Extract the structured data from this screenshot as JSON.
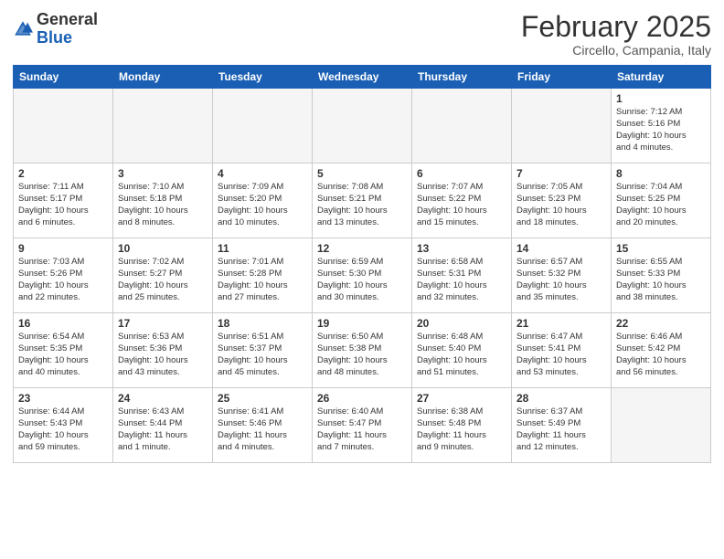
{
  "header": {
    "logo": {
      "general": "General",
      "blue": "Blue"
    },
    "title": "February 2025",
    "location": "Circello, Campania, Italy"
  },
  "weekdays": [
    "Sunday",
    "Monday",
    "Tuesday",
    "Wednesday",
    "Thursday",
    "Friday",
    "Saturday"
  ],
  "weeks": [
    [
      {
        "day": "",
        "info": ""
      },
      {
        "day": "",
        "info": ""
      },
      {
        "day": "",
        "info": ""
      },
      {
        "day": "",
        "info": ""
      },
      {
        "day": "",
        "info": ""
      },
      {
        "day": "",
        "info": ""
      },
      {
        "day": "1",
        "info": "Sunrise: 7:12 AM\nSunset: 5:16 PM\nDaylight: 10 hours\nand 4 minutes."
      }
    ],
    [
      {
        "day": "2",
        "info": "Sunrise: 7:11 AM\nSunset: 5:17 PM\nDaylight: 10 hours\nand 6 minutes."
      },
      {
        "day": "3",
        "info": "Sunrise: 7:10 AM\nSunset: 5:18 PM\nDaylight: 10 hours\nand 8 minutes."
      },
      {
        "day": "4",
        "info": "Sunrise: 7:09 AM\nSunset: 5:20 PM\nDaylight: 10 hours\nand 10 minutes."
      },
      {
        "day": "5",
        "info": "Sunrise: 7:08 AM\nSunset: 5:21 PM\nDaylight: 10 hours\nand 13 minutes."
      },
      {
        "day": "6",
        "info": "Sunrise: 7:07 AM\nSunset: 5:22 PM\nDaylight: 10 hours\nand 15 minutes."
      },
      {
        "day": "7",
        "info": "Sunrise: 7:05 AM\nSunset: 5:23 PM\nDaylight: 10 hours\nand 18 minutes."
      },
      {
        "day": "8",
        "info": "Sunrise: 7:04 AM\nSunset: 5:25 PM\nDaylight: 10 hours\nand 20 minutes."
      }
    ],
    [
      {
        "day": "9",
        "info": "Sunrise: 7:03 AM\nSunset: 5:26 PM\nDaylight: 10 hours\nand 22 minutes."
      },
      {
        "day": "10",
        "info": "Sunrise: 7:02 AM\nSunset: 5:27 PM\nDaylight: 10 hours\nand 25 minutes."
      },
      {
        "day": "11",
        "info": "Sunrise: 7:01 AM\nSunset: 5:28 PM\nDaylight: 10 hours\nand 27 minutes."
      },
      {
        "day": "12",
        "info": "Sunrise: 6:59 AM\nSunset: 5:30 PM\nDaylight: 10 hours\nand 30 minutes."
      },
      {
        "day": "13",
        "info": "Sunrise: 6:58 AM\nSunset: 5:31 PM\nDaylight: 10 hours\nand 32 minutes."
      },
      {
        "day": "14",
        "info": "Sunrise: 6:57 AM\nSunset: 5:32 PM\nDaylight: 10 hours\nand 35 minutes."
      },
      {
        "day": "15",
        "info": "Sunrise: 6:55 AM\nSunset: 5:33 PM\nDaylight: 10 hours\nand 38 minutes."
      }
    ],
    [
      {
        "day": "16",
        "info": "Sunrise: 6:54 AM\nSunset: 5:35 PM\nDaylight: 10 hours\nand 40 minutes."
      },
      {
        "day": "17",
        "info": "Sunrise: 6:53 AM\nSunset: 5:36 PM\nDaylight: 10 hours\nand 43 minutes."
      },
      {
        "day": "18",
        "info": "Sunrise: 6:51 AM\nSunset: 5:37 PM\nDaylight: 10 hours\nand 45 minutes."
      },
      {
        "day": "19",
        "info": "Sunrise: 6:50 AM\nSunset: 5:38 PM\nDaylight: 10 hours\nand 48 minutes."
      },
      {
        "day": "20",
        "info": "Sunrise: 6:48 AM\nSunset: 5:40 PM\nDaylight: 10 hours\nand 51 minutes."
      },
      {
        "day": "21",
        "info": "Sunrise: 6:47 AM\nSunset: 5:41 PM\nDaylight: 10 hours\nand 53 minutes."
      },
      {
        "day": "22",
        "info": "Sunrise: 6:46 AM\nSunset: 5:42 PM\nDaylight: 10 hours\nand 56 minutes."
      }
    ],
    [
      {
        "day": "23",
        "info": "Sunrise: 6:44 AM\nSunset: 5:43 PM\nDaylight: 10 hours\nand 59 minutes."
      },
      {
        "day": "24",
        "info": "Sunrise: 6:43 AM\nSunset: 5:44 PM\nDaylight: 11 hours\nand 1 minute."
      },
      {
        "day": "25",
        "info": "Sunrise: 6:41 AM\nSunset: 5:46 PM\nDaylight: 11 hours\nand 4 minutes."
      },
      {
        "day": "26",
        "info": "Sunrise: 6:40 AM\nSunset: 5:47 PM\nDaylight: 11 hours\nand 7 minutes."
      },
      {
        "day": "27",
        "info": "Sunrise: 6:38 AM\nSunset: 5:48 PM\nDaylight: 11 hours\nand 9 minutes."
      },
      {
        "day": "28",
        "info": "Sunrise: 6:37 AM\nSunset: 5:49 PM\nDaylight: 11 hours\nand 12 minutes."
      },
      {
        "day": "",
        "info": ""
      }
    ]
  ]
}
